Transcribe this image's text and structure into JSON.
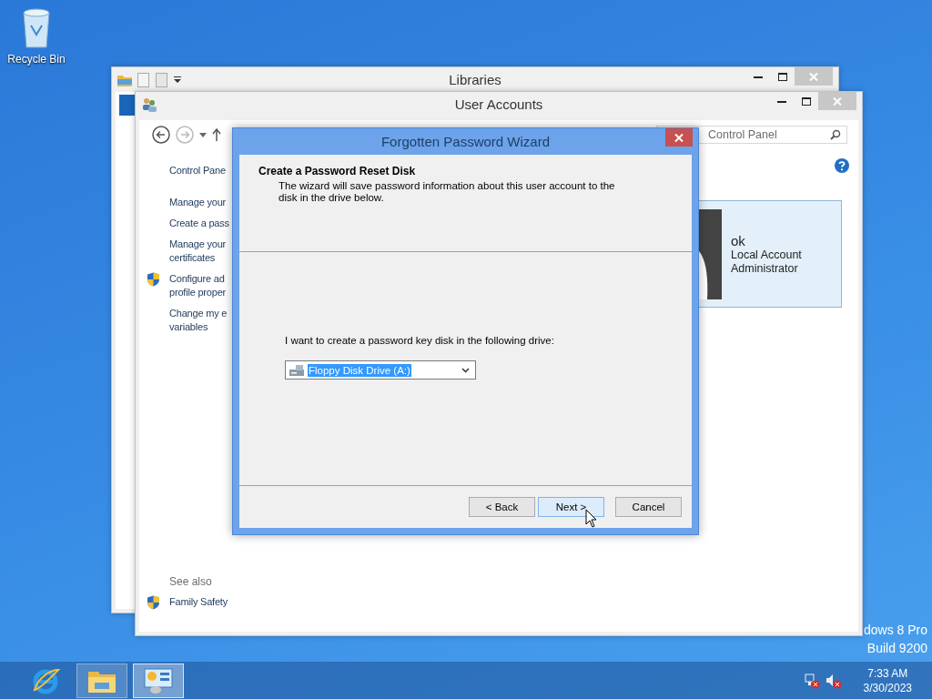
{
  "desktop": {
    "icons": [
      {
        "label": "Recycle Bin"
      }
    ],
    "edition": [
      "dows 8 Pro",
      "Build 9200"
    ]
  },
  "libraries_window": {
    "title": "Libraries"
  },
  "user_accounts_window": {
    "title": "User Accounts",
    "search": {
      "placeholder": "Control Panel"
    },
    "sidebar": {
      "items": [
        {
          "lines": [
            "Control Pane"
          ],
          "kind": "link"
        },
        {
          "lines": [
            "Manage your"
          ],
          "kind": "link"
        },
        {
          "lines": [
            "Create a pass"
          ],
          "kind": "link"
        },
        {
          "lines": [
            "Manage your",
            "certificates"
          ],
          "kind": "link"
        },
        {
          "lines": [
            "Configure ad",
            "profile proper"
          ],
          "kind": "shield"
        },
        {
          "lines": [
            "Change my e",
            "variables"
          ],
          "kind": "link"
        }
      ]
    },
    "account": {
      "name": "ok",
      "type": "Local Account",
      "role": "Administrator"
    },
    "see_also": {
      "heading": "See also",
      "items": [
        {
          "label": "Family Safety",
          "kind": "shield"
        }
      ]
    }
  },
  "wizard": {
    "title": "Forgotten Password Wizard",
    "heading": "Create a Password Reset Disk",
    "description": "The wizard will save password information about this user account to the disk in the drive below.",
    "prompt": "I want to create a password key disk in the following drive:",
    "drive": {
      "value": "Floppy Disk Drive (A:)"
    },
    "buttons": [
      {
        "label": "< Back",
        "hovered": false
      },
      {
        "label": "Next >",
        "hovered": true
      },
      {
        "label": "Cancel",
        "hovered": false
      }
    ]
  },
  "taskbar": {
    "apps": [
      {
        "kind": "ie",
        "running": false,
        "selected": false
      },
      {
        "kind": "explorer",
        "running": true,
        "selected": false
      },
      {
        "kind": "control-panel",
        "running": true,
        "selected": true
      }
    ],
    "clock": {
      "time": "7:33 AM",
      "date": "3/30/2023"
    }
  }
}
